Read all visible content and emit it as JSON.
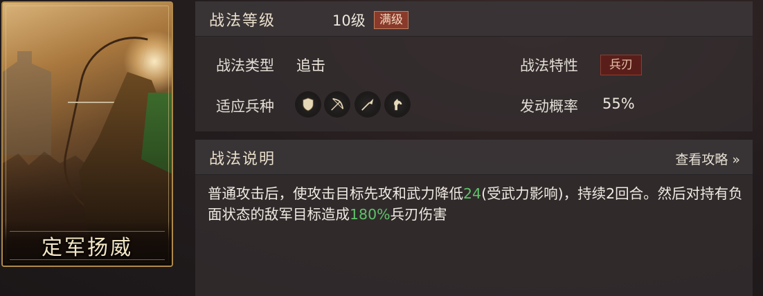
{
  "card": {
    "name": "定军扬威"
  },
  "panel_top": {
    "header_title": "战法等级",
    "level": "10级",
    "max_badge": "满级",
    "type_label": "战法类型",
    "type_value": "追击",
    "trait_label": "战法特性",
    "trait_value": "兵刃",
    "troop_label": "适应兵种",
    "troop_icons": [
      "shield-icon",
      "bow-icon",
      "spear-icon",
      "horse-icon"
    ],
    "rate_label": "发动概率",
    "rate_value": "55%"
  },
  "panel_bottom": {
    "header_title": "战法说明",
    "guide_link": "查看攻略 »",
    "description": {
      "p1": "普通攻击后，使攻击目标先攻和武力降低",
      "h1": "24",
      "p2": "(受武力影响)，持续2回合。然后对持有负面状态的敌军目标造成",
      "h2": "180%",
      "p3": "兵刃伤害"
    }
  },
  "colors": {
    "highlight": "#5fc36a",
    "max_badge_bg": "#8a3a2a",
    "trait_badge_bg": "#5a1e1a",
    "card_border": "#b08a4a"
  }
}
